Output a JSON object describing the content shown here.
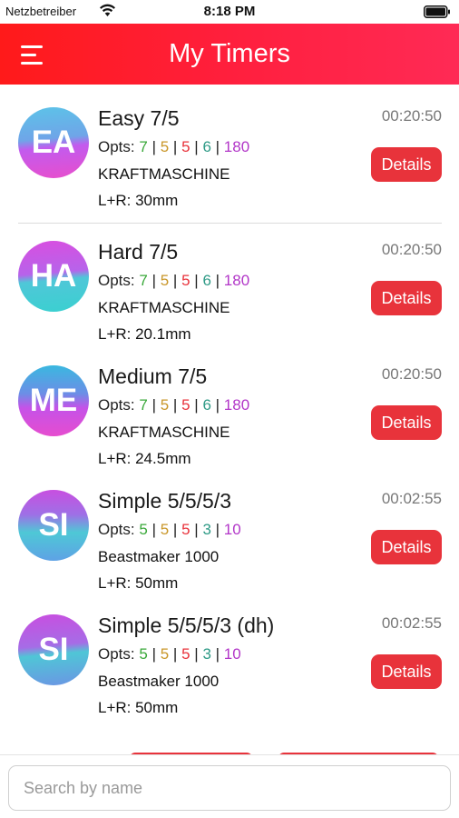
{
  "status_bar": {
    "carrier": "Netzbetreiber",
    "time": "8:18 PM"
  },
  "header": {
    "title": "My Timers"
  },
  "timers": [
    {
      "initials": "EA",
      "name": "Easy 7/5",
      "duration": "00:20:50",
      "opts_label": "Opts:",
      "opts": [
        "7",
        "5",
        "5",
        "6",
        "180"
      ],
      "equipment": "KRAFTMASCHINE",
      "edge": "L+R: 30mm",
      "button": "Details"
    },
    {
      "initials": "HA",
      "name": "Hard 7/5",
      "duration": "00:20:50",
      "opts_label": "Opts:",
      "opts": [
        "7",
        "5",
        "5",
        "6",
        "180"
      ],
      "equipment": "KRAFTMASCHINE",
      "edge": "L+R: 20.1mm",
      "button": "Details"
    },
    {
      "initials": "ME",
      "name": "Medium 7/5",
      "duration": "00:20:50",
      "opts_label": "Opts:",
      "opts": [
        "7",
        "5",
        "5",
        "6",
        "180"
      ],
      "equipment": "KRAFTMASCHINE",
      "edge": "L+R: 24.5mm",
      "button": "Details"
    },
    {
      "initials": "SI",
      "name": "Simple 5/5/5/3",
      "duration": "00:02:55",
      "opts_label": "Opts:",
      "opts": [
        "5",
        "5",
        "5",
        "3",
        "10"
      ],
      "equipment": "Beastmaker 1000",
      "edge": "L+R: 50mm",
      "button": "Details"
    },
    {
      "initials": "SI",
      "name": "Simple 5/5/5/3 (dh)",
      "duration": "00:02:55",
      "opts_label": "Opts:",
      "opts": [
        "5",
        "5",
        "5",
        "3",
        "10"
      ],
      "equipment": "Beastmaker 1000",
      "edge": "L+R: 50mm",
      "button": "Details"
    }
  ],
  "opts_separator": "|",
  "search": {
    "placeholder": "Search by name",
    "value": ""
  },
  "colors": {
    "accent": "#ff1f3d",
    "button": "#e8333b",
    "opt_colors": [
      "#3aa83a",
      "#c99628",
      "#e8313a",
      "#2e9a86",
      "#b236c8"
    ]
  }
}
